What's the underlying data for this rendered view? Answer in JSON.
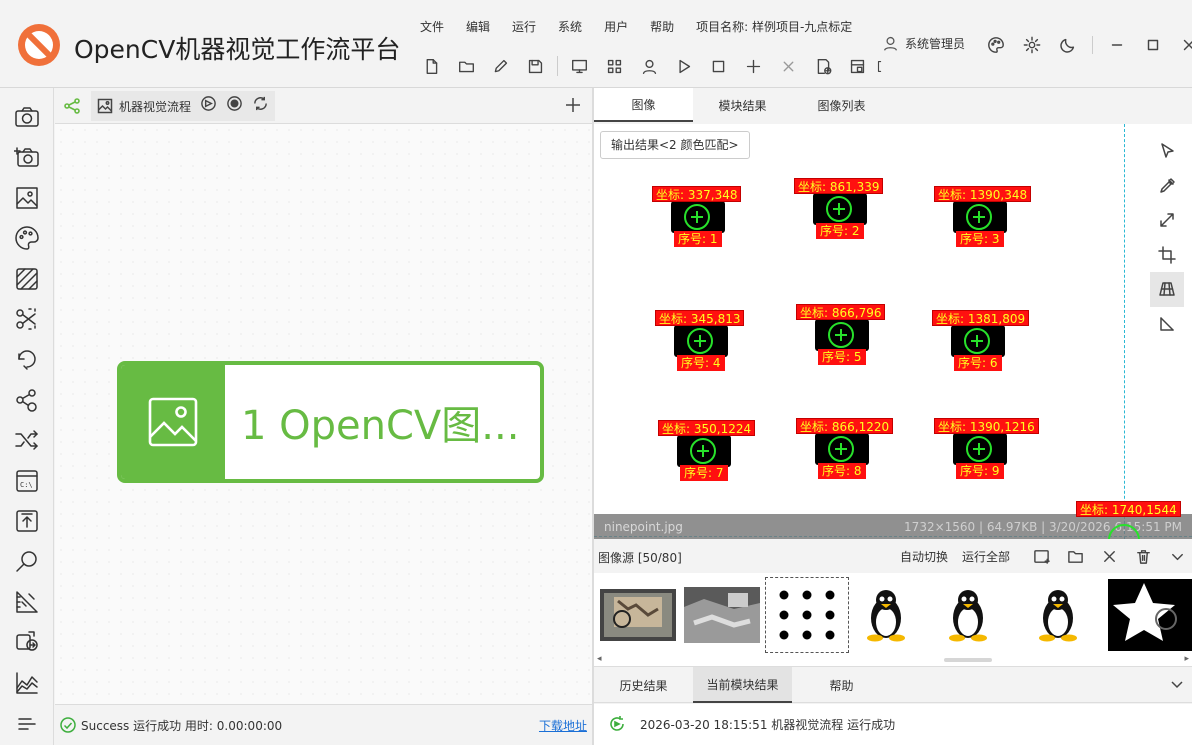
{
  "app": {
    "title": "OpenCV机器视觉工作流平台",
    "menus": [
      "文件",
      "编辑",
      "运行",
      "系统",
      "用户",
      "帮助"
    ],
    "project_label": "项目名称:  样例项目-九点标定",
    "user": "系统管理员",
    "accent_color": "#67bb43"
  },
  "flow": {
    "tab_label": "机器视觉流程",
    "node_label": "1 OpenCV图...",
    "node_color": "#67bb43"
  },
  "status": {
    "text": "Success 运行成功 用时: 0.00:00:00",
    "link": "下载地址"
  },
  "right_tabs": [
    "图像",
    "模块结果",
    "图像列表"
  ],
  "viewer": {
    "output_button": "输出结果<2 颜色匹配>",
    "image_name": "ninepoint.jpg",
    "image_meta": "1732×1560 | 64.97KB | 3/20/2026 6:15:51 PM",
    "points": [
      {
        "coord": "坐标: 337,348",
        "index": "序号: 1"
      },
      {
        "coord": "坐标: 861,339",
        "index": "序号: 2"
      },
      {
        "coord": "坐标: 1390,348",
        "index": "序号: 3"
      },
      {
        "coord": "坐标: 345,813",
        "index": "序号: 4"
      },
      {
        "coord": "坐标: 866,796",
        "index": "序号: 5"
      },
      {
        "coord": "坐标: 1381,809",
        "index": "序号: 6"
      },
      {
        "coord": "坐标: 350,1224",
        "index": "序号: 7"
      },
      {
        "coord": "坐标: 866,1220",
        "index": "序号: 8"
      },
      {
        "coord": "坐标: 1390,1216",
        "index": "序号: 9"
      }
    ],
    "cursor_coord": "坐标: 1740,1544",
    "label_bg": "#ff1010",
    "label_fg": "#ffff20",
    "mark_color": "#28e12b"
  },
  "source": {
    "title": "图像源 [50/80]",
    "auto_switch": "自动切换",
    "run_all": "运行全部"
  },
  "result_tabs": [
    "历史结果",
    "当前模块结果",
    "帮助"
  ],
  "log": {
    "text": "2026-03-20 18:15:51  机器视觉流程 运行成功"
  }
}
